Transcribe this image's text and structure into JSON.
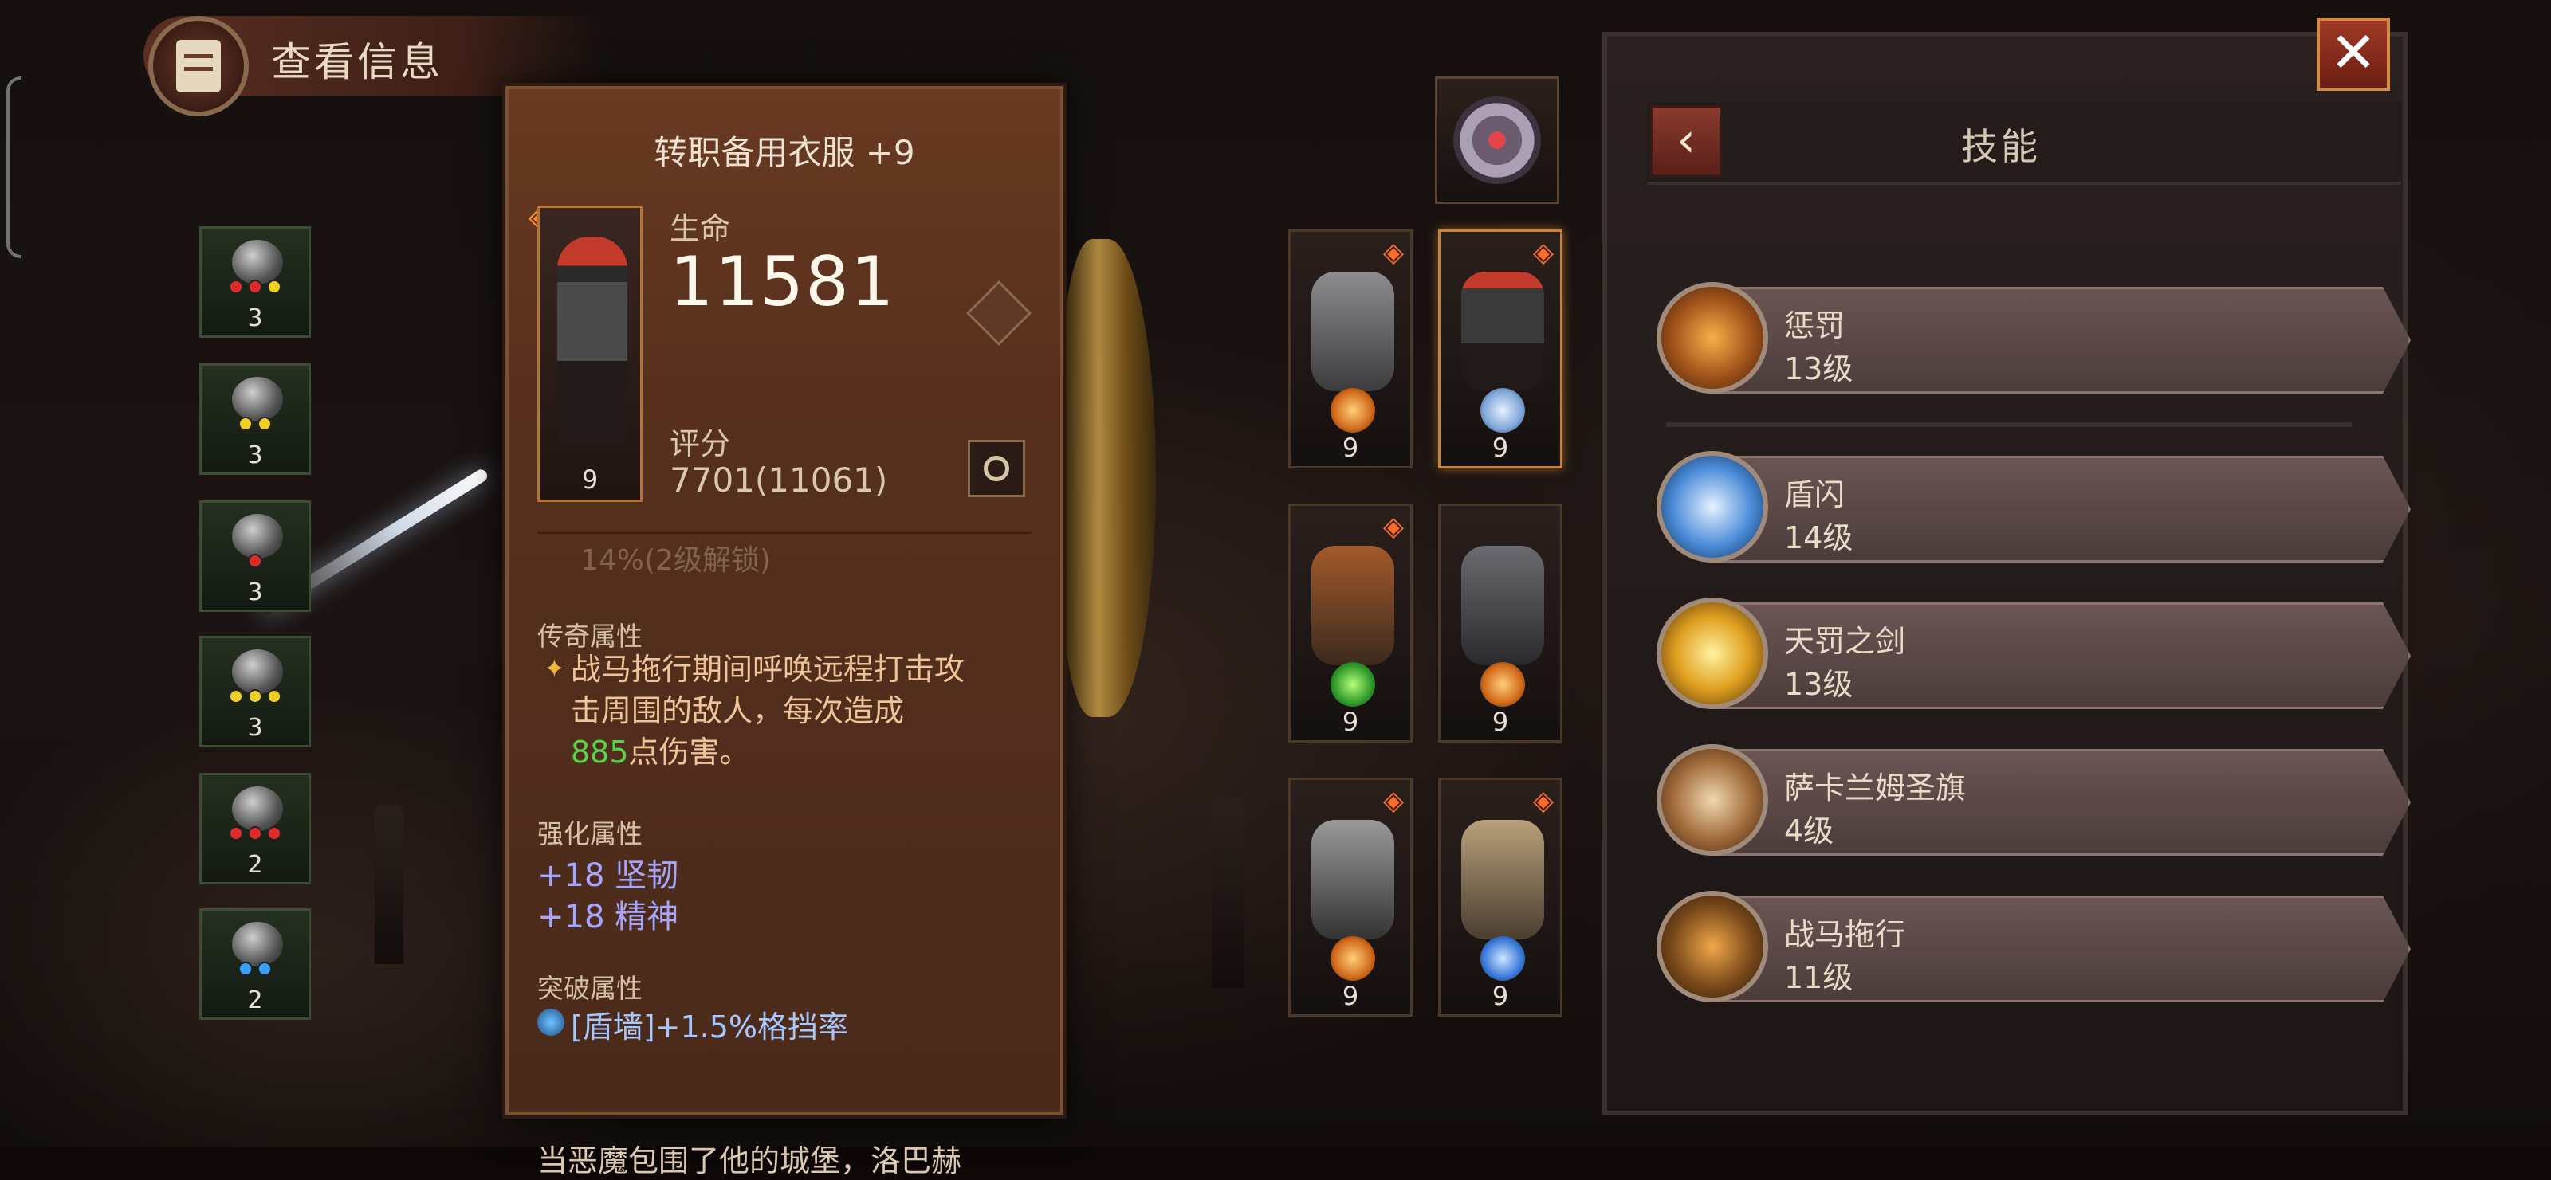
{
  "header": {
    "title": "查看信息"
  },
  "accessories": [
    {
      "count": "3"
    },
    {
      "count": "3"
    },
    {
      "count": "3"
    },
    {
      "count": "3"
    },
    {
      "count": "2"
    },
    {
      "count": "2"
    }
  ],
  "item": {
    "name": "转职备用衣服 +9",
    "level": "9",
    "hp_label": "生命",
    "hp_value": "11581",
    "score_label": "评分",
    "score_value": "7701(11061)",
    "faded_text": "14%(2级解锁)",
    "legendary_header": "传奇属性",
    "legendary_line1": "战马拖行期间呼唤远程打击攻",
    "legendary_line2": "击周围的敌人，每次造成",
    "legendary_damage": "885",
    "legendary_suffix": "点伤害。",
    "enhance_header": "强化属性",
    "enhance_stats": [
      "+18 坚韧",
      "+18 精神"
    ],
    "breakthrough_header": "突破属性",
    "breakthrough_stat": "[盾墙]+1.5%格挡率",
    "lore_text": "当恶魔包围了他的城堡，洛巴赫"
  },
  "equipment": [
    {
      "level": "9"
    },
    {
      "level": "9"
    },
    {
      "level": "9"
    },
    {
      "level": "9"
    },
    {
      "level": "9"
    },
    {
      "level": "9"
    }
  ],
  "skills": {
    "title": "技能",
    "back_icon": "chevron-left-icon",
    "close_icon": "close-icon",
    "items": [
      {
        "name": "惩罚",
        "level": "13级"
      },
      {
        "name": "盾闪",
        "level": "14级"
      },
      {
        "name": "天罚之剑",
        "level": "13级"
      },
      {
        "name": "萨卡兰姆圣旗",
        "level": "4级"
      },
      {
        "name": "战马拖行",
        "level": "11级"
      }
    ]
  },
  "colors": {
    "panel_bg": "#56301d",
    "legend_text": "#f0c49a",
    "damage_green": "#5bd24a",
    "enhance_blue": "#a7a6ff",
    "close_red": "#a03a25",
    "badge_orange": "#ff6a26"
  }
}
